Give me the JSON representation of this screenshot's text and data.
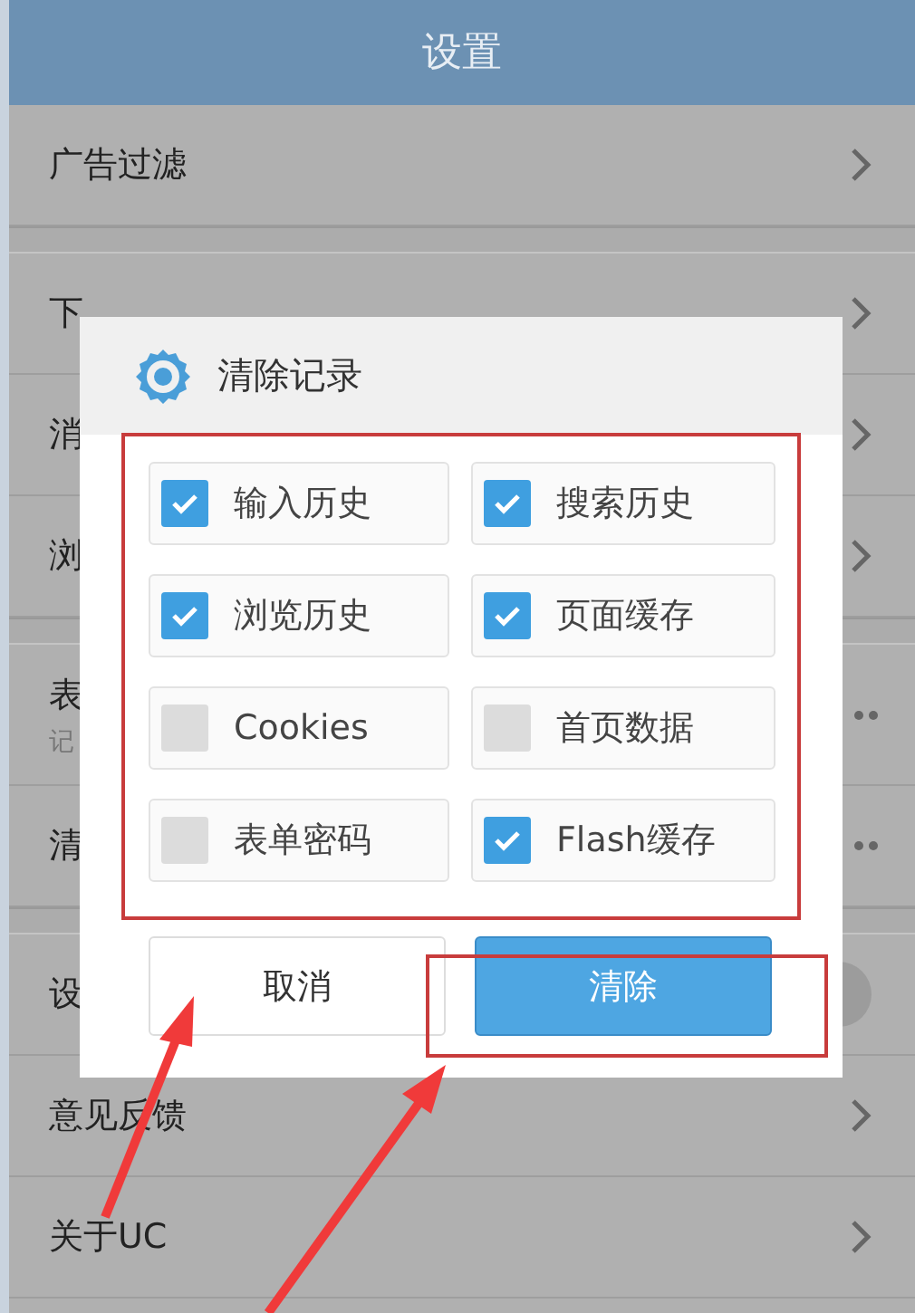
{
  "header": {
    "title": "设置"
  },
  "sections": [
    {
      "rows": [
        {
          "label": "广告过滤",
          "kind": "chevron"
        }
      ]
    },
    {
      "rows": [
        {
          "label": "下",
          "kind": "chevron"
        },
        {
          "label": "消",
          "kind": "chevron"
        },
        {
          "label": "浏",
          "kind": "chevron"
        }
      ]
    },
    {
      "rows": [
        {
          "label": "表",
          "sublabel": "记",
          "kind": "more"
        },
        {
          "label": "清",
          "kind": "more"
        }
      ]
    },
    {
      "rows": [
        {
          "label": "设",
          "kind": "toggle",
          "on": false
        },
        {
          "label": "意见反馈",
          "kind": "chevron"
        },
        {
          "label": "关于UC",
          "kind": "chevron"
        }
      ]
    }
  ],
  "dialog": {
    "title": "清除记录",
    "options": [
      {
        "label": "输入历史",
        "checked": true
      },
      {
        "label": "搜索历史",
        "checked": true
      },
      {
        "label": "浏览历史",
        "checked": true
      },
      {
        "label": "页面缓存",
        "checked": true
      },
      {
        "label": "Cookies",
        "checked": false
      },
      {
        "label": "首页数据",
        "checked": false
      },
      {
        "label": "表单密码",
        "checked": false
      },
      {
        "label": "Flash缓存",
        "checked": true
      }
    ],
    "buttons": [
      {
        "label": "取消",
        "kind": "secondary"
      },
      {
        "label": "清除",
        "kind": "primary"
      }
    ]
  }
}
